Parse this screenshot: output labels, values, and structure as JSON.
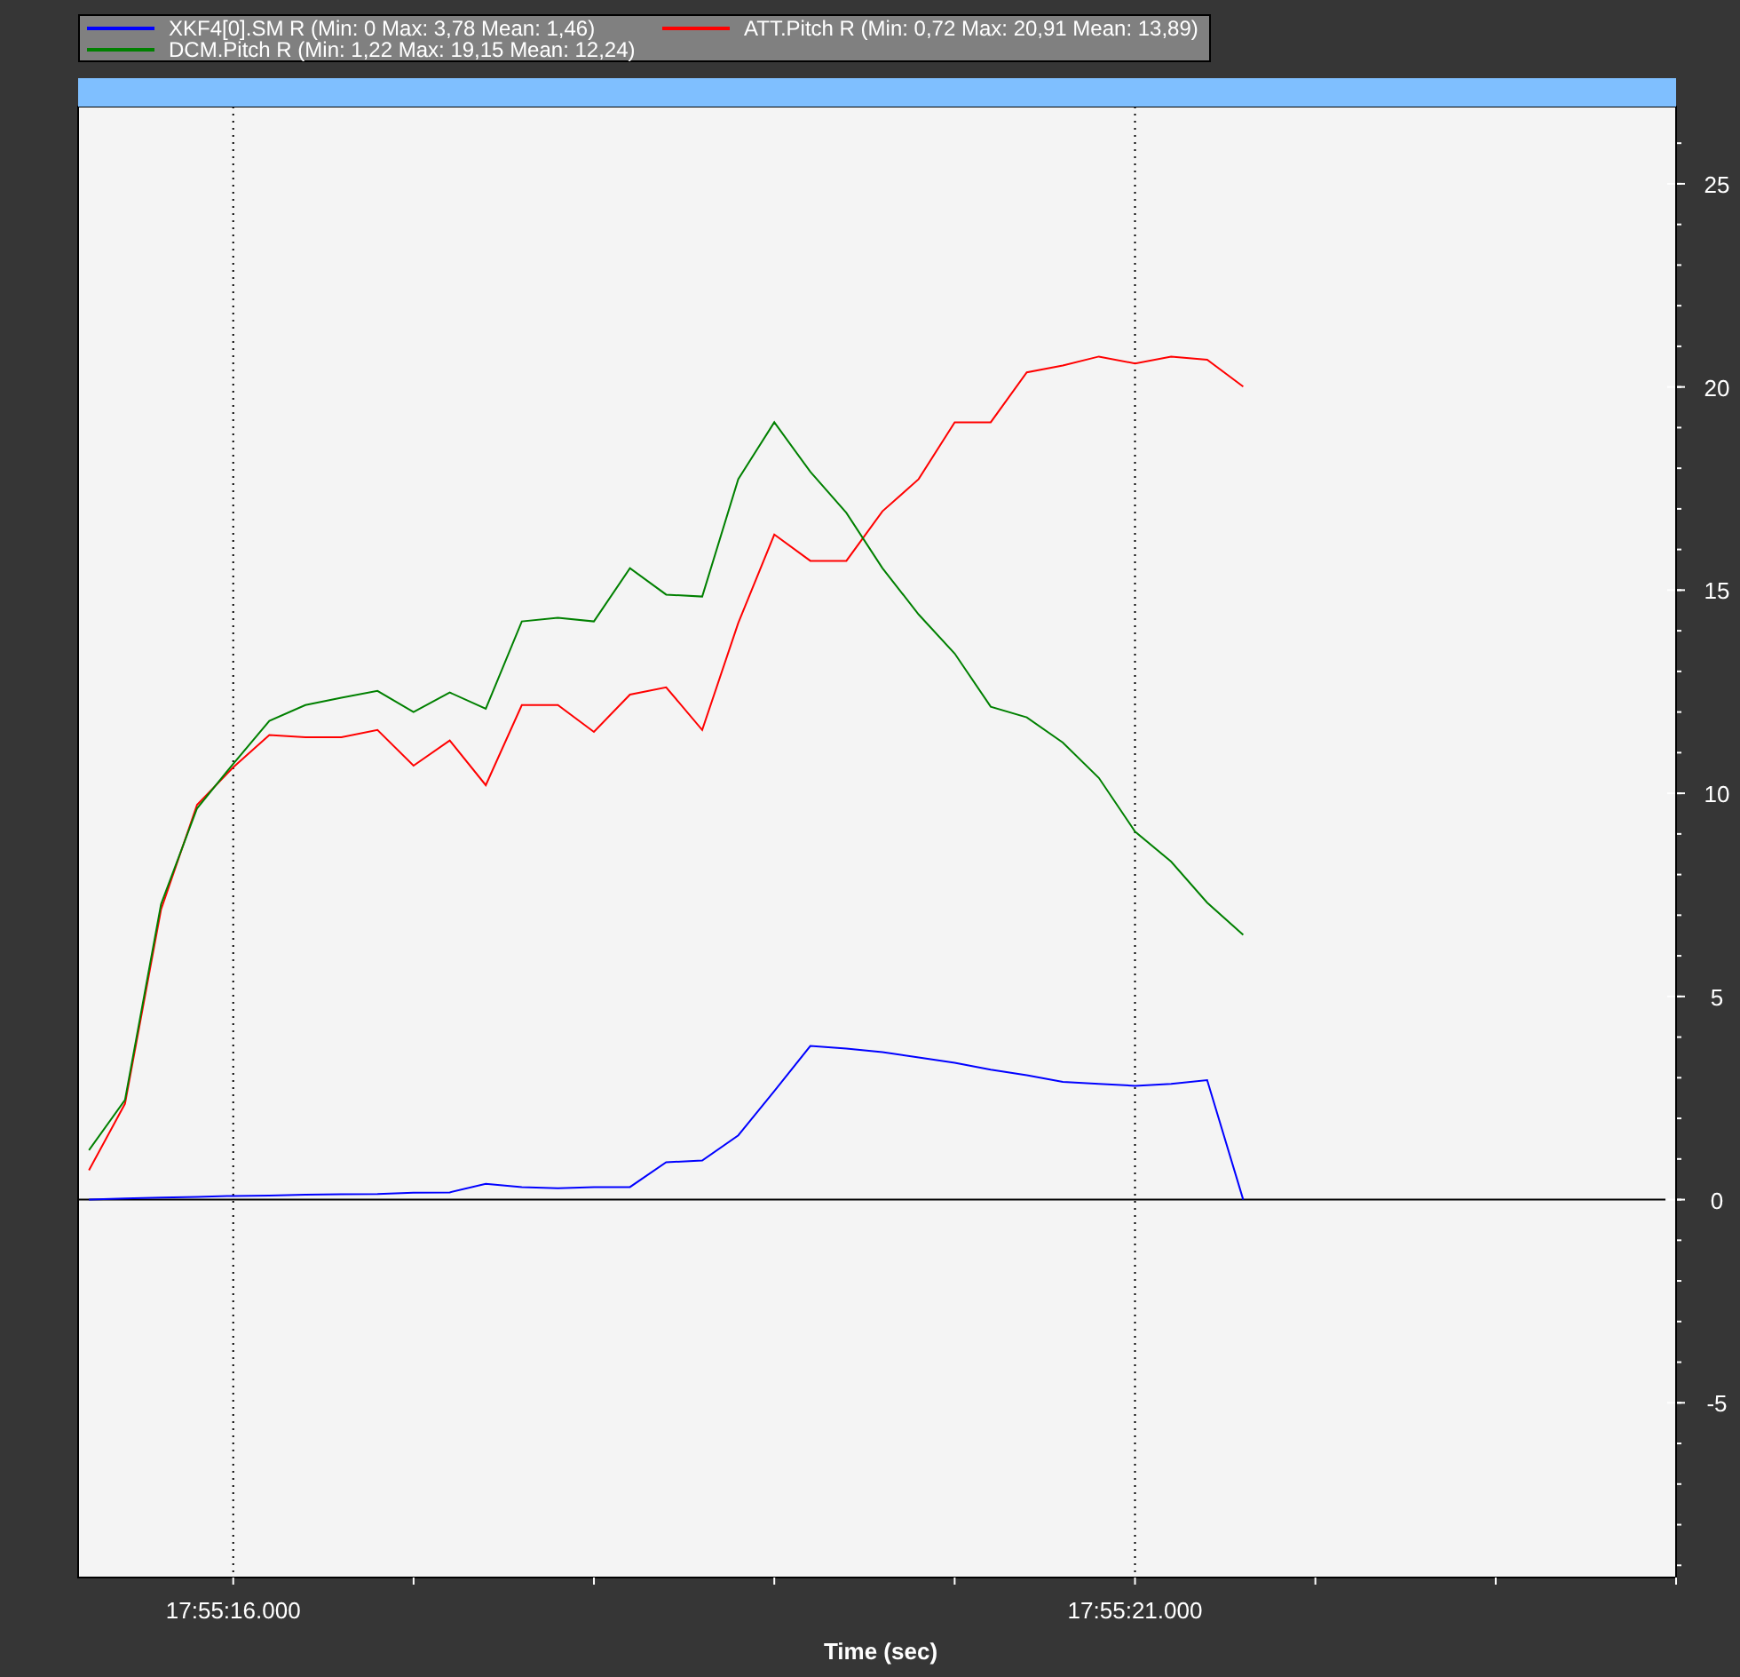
{
  "chart_data": {
    "type": "line",
    "xlabel": "Time (sec)",
    "ylim": [
      -9.3,
      26.9
    ],
    "yticks": [
      -5,
      0,
      5,
      10,
      15,
      20,
      25
    ],
    "categories": [
      null,
      null,
      null,
      null,
      "17:55:16.000",
      null,
      null,
      null,
      null,
      null,
      null,
      null,
      null,
      null,
      null,
      null,
      null,
      null,
      null,
      null,
      null,
      null,
      null,
      null,
      null,
      null,
      null,
      null,
      null,
      "17:55:21.000",
      null,
      null,
      null
    ],
    "series": [
      {
        "name": "XKF4[0].SM  R (Min: 0 Max: 3,78 Mean: 1,46)",
        "color": "#0000ff",
        "values": [
          0,
          0.03,
          0.05,
          0.07,
          0.09,
          0.1,
          0.12,
          0.13,
          0.14,
          0.17,
          0.18,
          0.39,
          0.31,
          0.28,
          0.31,
          0.31,
          0.92,
          0.96,
          1.58,
          2.67,
          3.78,
          3.72,
          3.63,
          3.5,
          3.37,
          3.2,
          3.06,
          2.9,
          2.85,
          2.8,
          2.85,
          2.94,
          0
        ]
      },
      {
        "name": "ATT.Pitch  R (Min: 0,72 Max: 20,91 Mean: 13,89)",
        "color": "#ff0000",
        "values": [
          0.72,
          2.36,
          7.14,
          9.72,
          10.64,
          11.43,
          11.38,
          11.38,
          11.56,
          10.68,
          11.3,
          10.2,
          12.17,
          12.17,
          11.51,
          12.43,
          12.61,
          11.56,
          14.19,
          16.37,
          15.72,
          15.72,
          16.94,
          17.73,
          19.13,
          19.13,
          20.36,
          20.53,
          20.75,
          20.58,
          20.75,
          20.67,
          20.01
        ]
      },
      {
        "name": "DCM.Pitch  R (Min: 1,22 Max: 19,15 Mean: 12,24)",
        "color": "#008000",
        "values": [
          1.22,
          2.45,
          7.27,
          9.63,
          10.73,
          11.78,
          12.17,
          12.35,
          12.52,
          12.0,
          12.48,
          12.08,
          14.23,
          14.32,
          14.23,
          15.54,
          14.89,
          14.84,
          17.73,
          19.13,
          17.91,
          16.9,
          15.54,
          14.4,
          13.44,
          12.13,
          11.87,
          11.25,
          10.38,
          9.06,
          8.32,
          7.31,
          6.52
        ]
      }
    ]
  }
}
